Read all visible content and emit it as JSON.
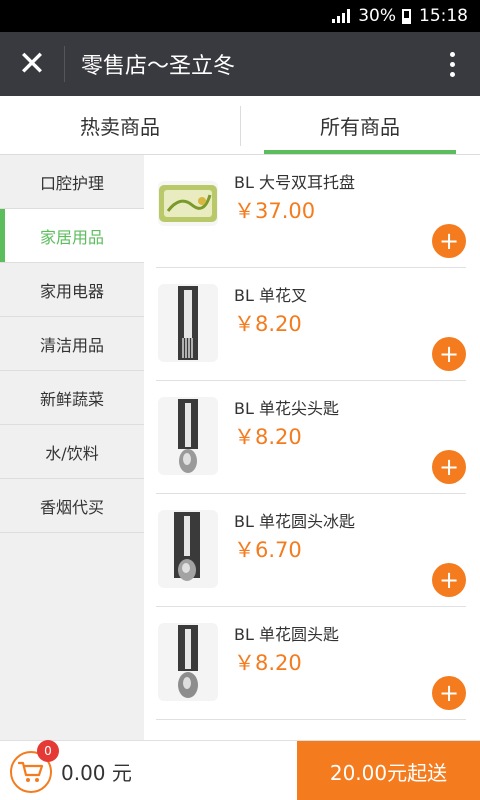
{
  "status_bar": {
    "battery": "30%",
    "time": "15:18"
  },
  "nav": {
    "title": "零售店～圣立冬",
    "close_icon": "close-icon",
    "more_icon": "more-vertical-icon"
  },
  "tabs": [
    {
      "label": "热卖商品",
      "active": false
    },
    {
      "label": "所有商品",
      "active": true
    }
  ],
  "categories": [
    {
      "label": "口腔护理"
    },
    {
      "label": "家居用品"
    },
    {
      "label": "家用电器"
    },
    {
      "label": "清洁用品"
    },
    {
      "label": "新鲜蔬菜"
    },
    {
      "label": "水/饮料"
    },
    {
      "label": "香烟代买"
    }
  ],
  "selected_category": "家居用品",
  "products": [
    {
      "name": "BL 大号双耳托盘",
      "price": "￥37.00",
      "image": "tray"
    },
    {
      "name": "BL 单花叉",
      "price": "￥8.20",
      "image": "fork"
    },
    {
      "name": "BL 单花尖头匙",
      "price": "￥8.20",
      "image": "spoon"
    },
    {
      "name": "BL 单花圆头冰匙",
      "price": "￥6.70",
      "image": "spoon"
    },
    {
      "name": "BL 单花圆头匙",
      "price": "￥8.20",
      "image": "spoon"
    }
  ],
  "add_label": "+",
  "cart": {
    "count": "0",
    "total": "0.00 元",
    "min_order": "20.00元起送"
  },
  "colors": {
    "accent_green": "#5cbd5d",
    "accent_orange": "#f47b1e",
    "nav_bg": "#393a3f"
  }
}
